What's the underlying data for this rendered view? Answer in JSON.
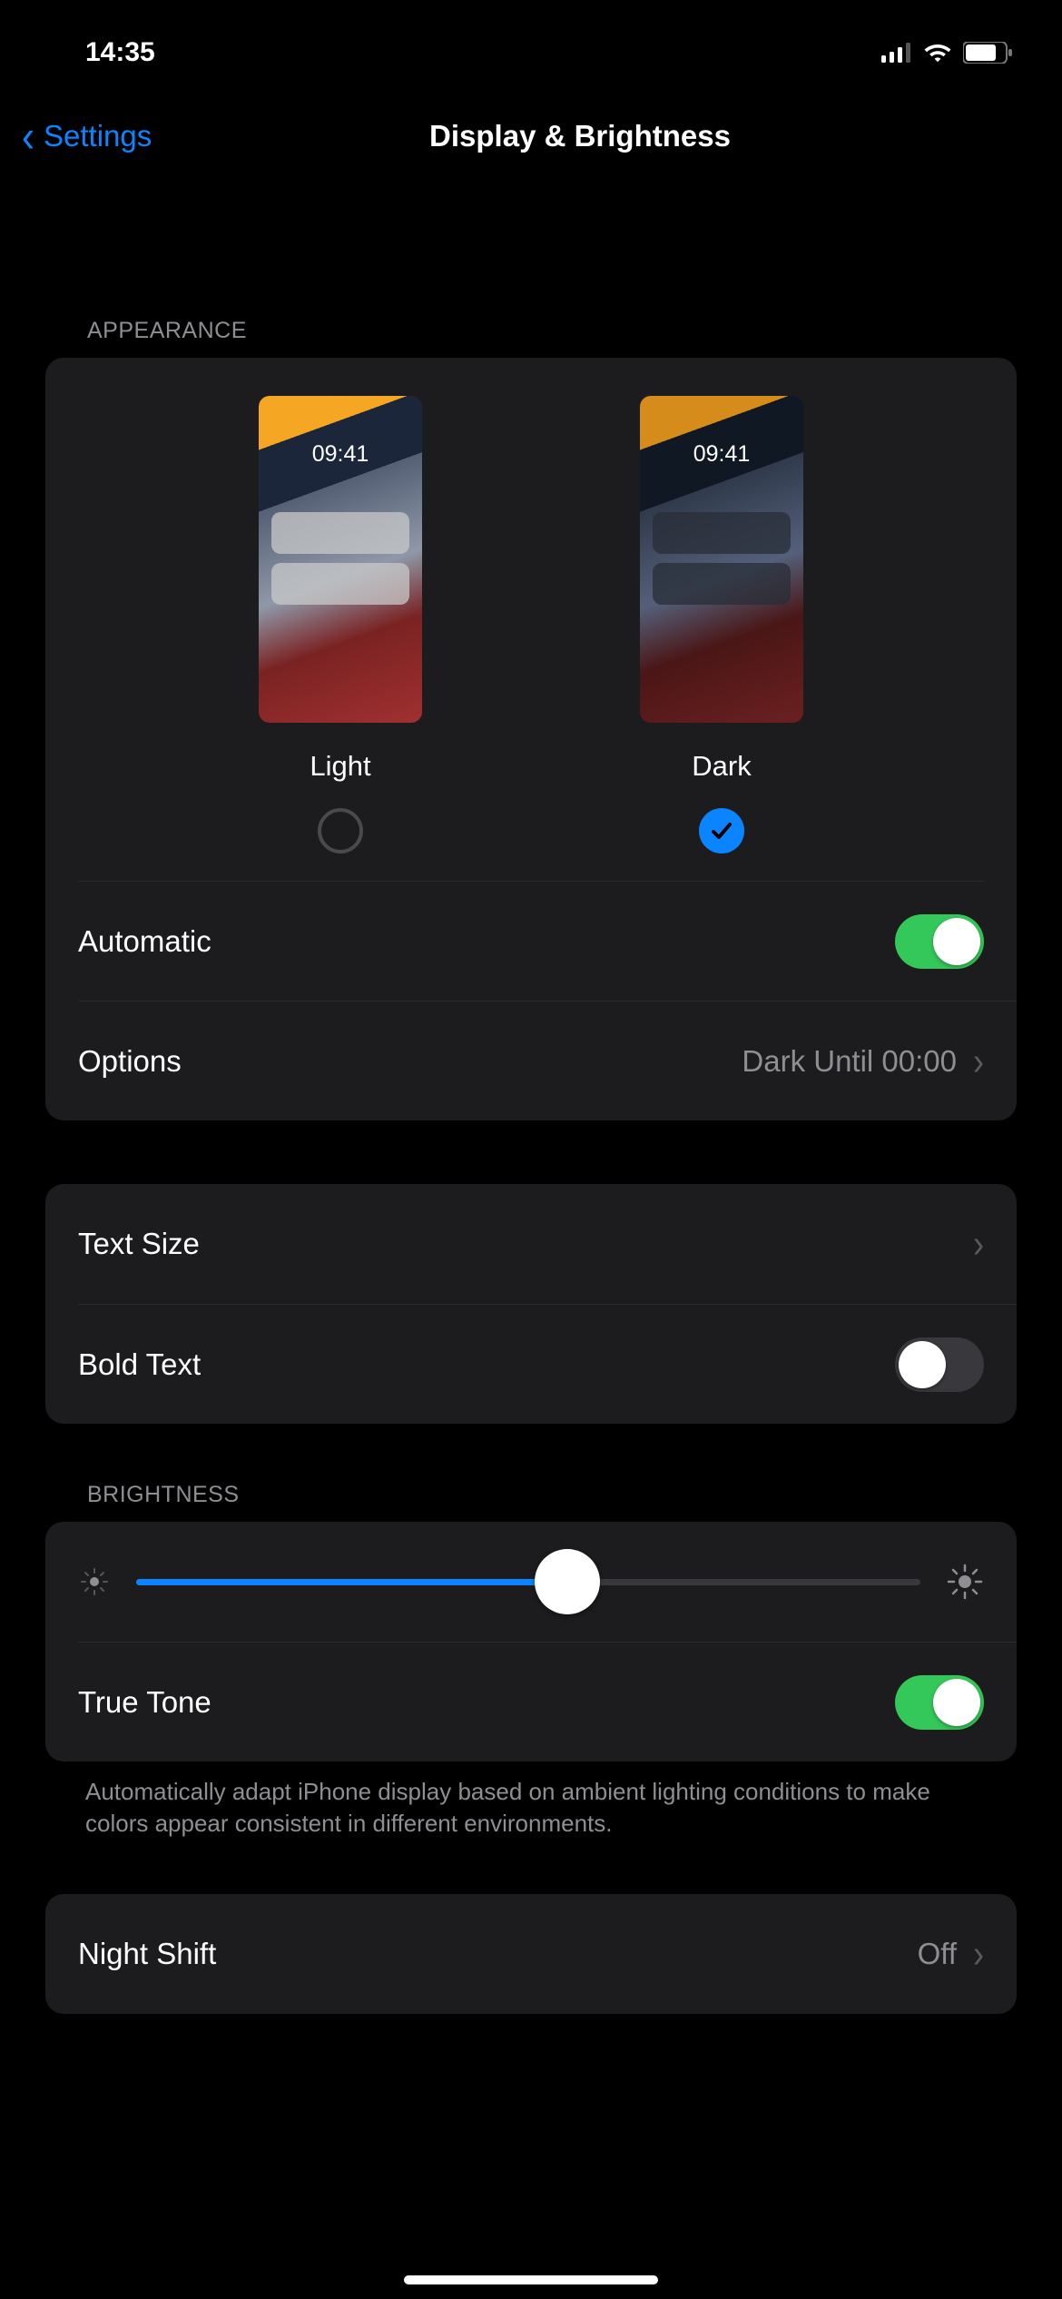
{
  "status": {
    "time": "14:35",
    "signal": "cell-signal",
    "wifi": "wifi-icon",
    "battery": "battery-icon"
  },
  "nav": {
    "back_label": "Settings",
    "title": "Display & Brightness"
  },
  "appearance": {
    "header": "APPEARANCE",
    "preview_time": "09:41",
    "light": {
      "label": "Light",
      "selected": false
    },
    "dark": {
      "label": "Dark",
      "selected": true
    },
    "automatic": {
      "label": "Automatic",
      "on": true
    },
    "options": {
      "label": "Options",
      "value": "Dark Until 00:00"
    }
  },
  "text": {
    "text_size": {
      "label": "Text Size"
    },
    "bold_text": {
      "label": "Bold Text",
      "on": false
    }
  },
  "brightness": {
    "header": "BRIGHTNESS",
    "slider_percent": 55,
    "true_tone": {
      "label": "True Tone",
      "on": true
    },
    "footer": "Automatically adapt iPhone display based on ambient lighting conditions to make colors appear consistent in different environments."
  },
  "night_shift": {
    "label": "Night Shift",
    "value": "Off"
  }
}
